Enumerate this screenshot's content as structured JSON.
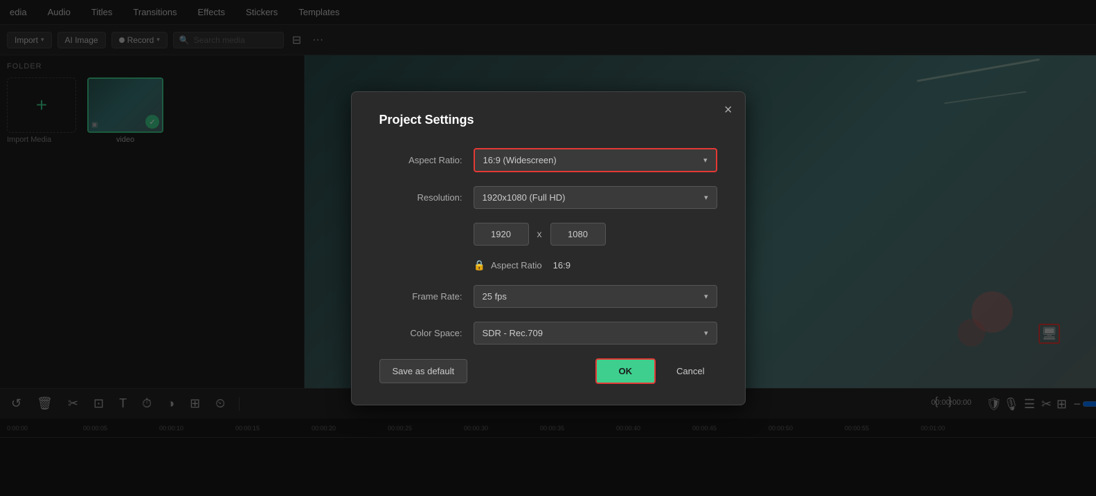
{
  "menu": {
    "items": [
      "edia",
      "Audio",
      "Titles",
      "Transitions",
      "Effects",
      "Stickers",
      "Templates"
    ]
  },
  "toolbar": {
    "import_label": "Import",
    "ai_image_label": "AI Image",
    "record_label": "Record",
    "search_placeholder": "Search media"
  },
  "left_panel": {
    "folder_label": "FOLDER",
    "import_media_label": "Import Media",
    "video_thumb_label": "video"
  },
  "dialog": {
    "title": "Project Settings",
    "close_label": "×",
    "aspect_ratio_label": "Aspect Ratio:",
    "aspect_ratio_value": "16:9 (Widescreen)",
    "resolution_label": "Resolution:",
    "resolution_value": "1920x1080 (Full HD)",
    "width_value": "1920",
    "height_value": "1080",
    "dim_x": "x",
    "lock_aspect_label": "Aspect Ratio",
    "lock_aspect_value": "16:9",
    "frame_rate_label": "Frame Rate:",
    "frame_rate_value": "25 fps",
    "color_space_label": "Color Space:",
    "color_space_value": "SDR - Rec.709",
    "save_default_label": "Save as default",
    "ok_label": "OK",
    "cancel_label": "Cancel"
  },
  "timeline": {
    "timestamp": "00:00:00:00",
    "ruler_ticks": [
      "0:00:00",
      "00:00:05",
      "00:00:10",
      "00:00:15",
      "00:00:20",
      "00:00:25",
      "00:00:30",
      "00:00:35",
      "00:00:40",
      "00:00:45",
      "00:00:50",
      "00:00:55",
      "00:01:00"
    ]
  }
}
